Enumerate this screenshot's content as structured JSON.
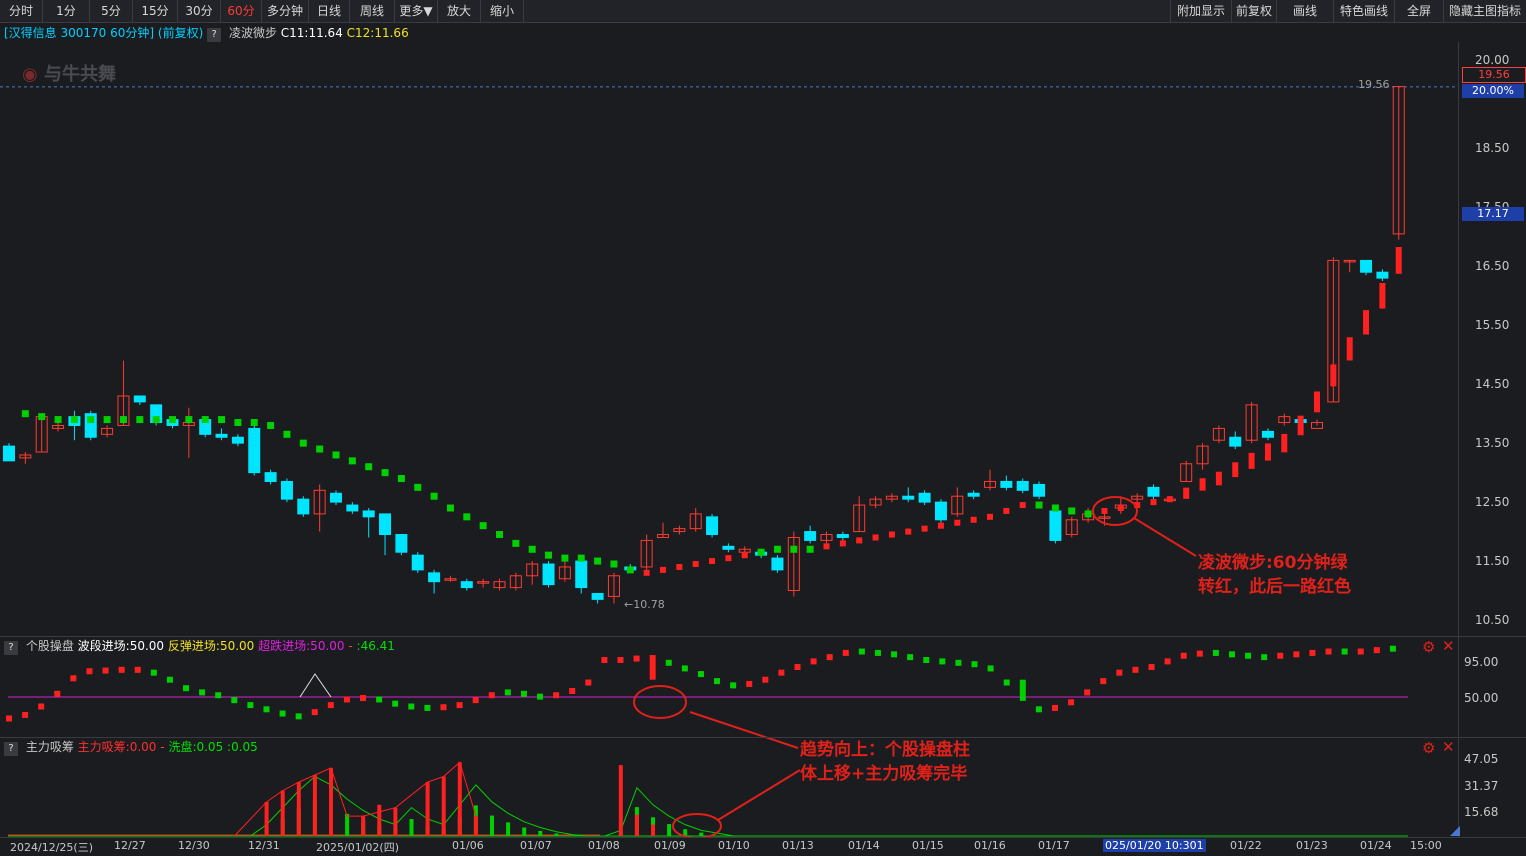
{
  "toolbar": {
    "left": [
      "分时",
      "1分",
      "5分",
      "15分",
      "30分",
      "60分",
      "多分钟",
      "日线",
      "周线",
      "更多▼",
      "放大",
      "缩小"
    ],
    "active_index": 5,
    "right": [
      "附加显示",
      "前复权",
      "画线",
      "特色画线",
      "全屏",
      "隐藏主图指标"
    ]
  },
  "header": {
    "stock": "[汉得信息 300170 60分钟]",
    "adjust": "(前复权)",
    "indicator_name": "凌波微步",
    "c1": "C11:11.64",
    "c2": "C12:11.66",
    "watermark": "与牛共舞"
  },
  "price_axis": {
    "labels": [
      "20.00",
      "18.50",
      "17.50",
      "16.50",
      "15.50",
      "14.50",
      "13.50",
      "12.50",
      "11.50",
      "10.50"
    ],
    "tag_high_price": "19.56",
    "tag_high_pct": "20.00%",
    "tag_last": "17.17",
    "peak_label": "19.56",
    "low_label": "10.78"
  },
  "panel2": {
    "name": "个股操盘",
    "s1": "波段进场:50.00",
    "s2": "反弹进场:50.00",
    "s3": "超跌进场:50.00",
    "s4": ":46.41",
    "labels": [
      "95.00",
      "50.00"
    ]
  },
  "panel3": {
    "name": "主力吸筹",
    "s1": "主力吸筹:0.00",
    "s2": "洗盘:0.05",
    "s3": ":0.05",
    "labels": [
      "47.05",
      "31.37",
      "15.68"
    ]
  },
  "dates": [
    "2024/12/25(三)",
    "12/27",
    "12/30",
    "12/31",
    "2025/01/02(四)",
    "01/06",
    "01/07",
    "01/08",
    "01/09",
    "01/10",
    "01/13",
    "01/14",
    "01/15",
    "01/16",
    "01/17",
    "025/01/20 10:301",
    "01/22",
    "01/23",
    "01/24",
    "15:00"
  ],
  "annotations": {
    "a1_line1": "凌波微步:60分钟绿",
    "a1_line2": "转红，此后一路红色",
    "a2_line1": "趋势向上：个股操盘柱",
    "a2_line2": "体上移+主力吸筹完毕"
  },
  "colors": {
    "up": "#ff3b30",
    "down": "#00e5ff",
    "green": "#00d000",
    "red": "#ff2020",
    "magenta": "#d020d0",
    "yellow": "#f0e020"
  },
  "chart_data": {
    "type": "candlestick",
    "ylim": [
      10.2,
      20.5
    ],
    "candles": [
      [
        13.45,
        13.2,
        13.5,
        13.2
      ],
      [
        13.25,
        13.3,
        13.35,
        13.15
      ],
      [
        13.35,
        13.95,
        14.0,
        13.35
      ],
      [
        13.75,
        13.8,
        13.95,
        13.7
      ],
      [
        13.95,
        13.8,
        14.05,
        13.55
      ],
      [
        14.0,
        13.6,
        14.05,
        13.55
      ],
      [
        13.65,
        13.75,
        13.8,
        13.6
      ],
      [
        13.8,
        14.3,
        14.9,
        13.8
      ],
      [
        14.3,
        14.2,
        14.3,
        14.15
      ],
      [
        14.15,
        13.85,
        14.15,
        13.8
      ],
      [
        13.9,
        13.8,
        13.95,
        13.75
      ],
      [
        13.8,
        13.85,
        14.1,
        13.25
      ],
      [
        13.9,
        13.65,
        13.9,
        13.6
      ],
      [
        13.65,
        13.6,
        13.75,
        13.55
      ],
      [
        13.6,
        13.5,
        13.65,
        13.45
      ],
      [
        13.75,
        13.0,
        13.8,
        12.95
      ],
      [
        13.0,
        12.85,
        13.05,
        12.8
      ],
      [
        12.85,
        12.55,
        12.9,
        12.5
      ],
      [
        12.55,
        12.3,
        12.6,
        12.25
      ],
      [
        12.3,
        12.7,
        12.8,
        12.0
      ],
      [
        12.65,
        12.5,
        12.7,
        12.45
      ],
      [
        12.45,
        12.35,
        12.5,
        12.3
      ],
      [
        12.35,
        12.25,
        12.4,
        11.9
      ],
      [
        12.3,
        11.95,
        12.3,
        11.6
      ],
      [
        11.95,
        11.65,
        11.95,
        11.6
      ],
      [
        11.6,
        11.35,
        11.65,
        11.3
      ],
      [
        11.3,
        11.15,
        11.35,
        10.95
      ],
      [
        11.2,
        11.2,
        11.25,
        11.15
      ],
      [
        11.15,
        11.05,
        11.2,
        11.0
      ],
      [
        11.15,
        11.15,
        11.2,
        11.05
      ],
      [
        11.05,
        11.15,
        11.2,
        11.0
      ],
      [
        11.05,
        11.25,
        11.3,
        11.0
      ],
      [
        11.25,
        11.45,
        11.5,
        11.1
      ],
      [
        11.45,
        11.1,
        11.5,
        11.05
      ],
      [
        11.2,
        11.4,
        11.5,
        11.15
      ],
      [
        11.5,
        11.05,
        11.6,
        10.95
      ],
      [
        10.95,
        10.85,
        10.95,
        10.78
      ],
      [
        10.9,
        11.25,
        11.3,
        10.78
      ],
      [
        11.4,
        11.35,
        11.45,
        11.3
      ],
      [
        11.4,
        11.85,
        11.95,
        11.35
      ],
      [
        11.9,
        11.95,
        12.15,
        11.9
      ],
      [
        12.0,
        12.05,
        12.1,
        11.95
      ],
      [
        12.05,
        12.3,
        12.4,
        12.0
      ],
      [
        12.25,
        11.95,
        12.3,
        11.9
      ],
      [
        11.75,
        11.7,
        11.8,
        11.65
      ],
      [
        11.65,
        11.7,
        11.75,
        11.6
      ],
      [
        11.65,
        11.6,
        11.7,
        11.55
      ],
      [
        11.55,
        11.35,
        11.6,
        11.3
      ],
      [
        11.0,
        11.9,
        12.0,
        10.9
      ],
      [
        12.0,
        11.85,
        12.1,
        11.8
      ],
      [
        11.85,
        11.95,
        12.0,
        11.8
      ],
      [
        11.95,
        11.9,
        12.0,
        11.85
      ],
      [
        12.0,
        12.45,
        12.6,
        12.0
      ],
      [
        12.45,
        12.55,
        12.6,
        12.4
      ],
      [
        12.55,
        12.6,
        12.65,
        12.5
      ],
      [
        12.6,
        12.55,
        12.75,
        12.5
      ],
      [
        12.65,
        12.5,
        12.7,
        12.45
      ],
      [
        12.5,
        12.2,
        12.55,
        12.15
      ],
      [
        12.3,
        12.6,
        12.75,
        12.25
      ],
      [
        12.65,
        12.6,
        12.7,
        12.55
      ],
      [
        12.75,
        12.85,
        13.05,
        12.7
      ],
      [
        12.85,
        12.75,
        12.95,
        12.7
      ],
      [
        12.85,
        12.7,
        12.9,
        12.65
      ],
      [
        12.8,
        12.6,
        12.85,
        12.55
      ],
      [
        12.35,
        11.85,
        12.4,
        11.8
      ],
      [
        11.95,
        12.2,
        12.25,
        11.9
      ],
      [
        12.2,
        12.3,
        12.4,
        12.15
      ],
      [
        12.25,
        12.25,
        12.3,
        12.1
      ],
      [
        12.4,
        12.45,
        12.6,
        12.3
      ],
      [
        12.55,
        12.6,
        12.65,
        12.5
      ],
      [
        12.75,
        12.6,
        12.8,
        12.55
      ],
      [
        12.55,
        12.55,
        12.6,
        12.5
      ],
      [
        12.85,
        13.15,
        13.2,
        12.85
      ],
      [
        13.15,
        13.45,
        13.5,
        13.05
      ],
      [
        13.55,
        13.75,
        13.8,
        13.5
      ],
      [
        13.6,
        13.45,
        13.7,
        13.4
      ],
      [
        13.55,
        14.15,
        14.2,
        13.5
      ],
      [
        13.7,
        13.6,
        13.75,
        13.55
      ],
      [
        13.85,
        13.95,
        14.0,
        13.8
      ],
      [
        13.9,
        13.85,
        13.95,
        13.8
      ],
      [
        13.75,
        13.85,
        13.9,
        13.8
      ],
      [
        14.2,
        16.6,
        16.65,
        14.2
      ],
      [
        16.6,
        16.6,
        16.6,
        16.4
      ],
      [
        16.6,
        16.4,
        16.6,
        16.35
      ],
      [
        16.4,
        16.3,
        16.45,
        16.25
      ],
      [
        17.05,
        19.55,
        19.56,
        16.95
      ]
    ],
    "lingbo": [
      [
        14.0,
        "g"
      ],
      [
        13.95,
        "g"
      ],
      [
        13.9,
        "g"
      ],
      [
        13.9,
        "g"
      ],
      [
        13.9,
        "g"
      ],
      [
        13.9,
        "g"
      ],
      [
        13.9,
        "g"
      ],
      [
        13.9,
        "g"
      ],
      [
        13.9,
        "g"
      ],
      [
        13.9,
        "g"
      ],
      [
        13.9,
        "g"
      ],
      [
        13.9,
        "g"
      ],
      [
        13.9,
        "g"
      ],
      [
        13.85,
        "g"
      ],
      [
        13.85,
        "g"
      ],
      [
        13.8,
        "g"
      ],
      [
        13.65,
        "g"
      ],
      [
        13.5,
        "g"
      ],
      [
        13.4,
        "g"
      ],
      [
        13.3,
        "g"
      ],
      [
        13.2,
        "g"
      ],
      [
        13.1,
        "g"
      ],
      [
        13.0,
        "g"
      ],
      [
        12.9,
        "g"
      ],
      [
        12.75,
        "g"
      ],
      [
        12.6,
        "g"
      ],
      [
        12.4,
        "g"
      ],
      [
        12.25,
        "g"
      ],
      [
        12.1,
        "g"
      ],
      [
        11.95,
        "g"
      ],
      [
        11.8,
        "g"
      ],
      [
        11.7,
        "g"
      ],
      [
        11.6,
        "g"
      ],
      [
        11.55,
        "g"
      ],
      [
        11.55,
        "g"
      ],
      [
        11.5,
        "g"
      ],
      [
        11.45,
        "g"
      ],
      [
        11.35,
        "g"
      ],
      [
        11.3,
        "r"
      ],
      [
        11.35,
        "r"
      ],
      [
        11.4,
        "r"
      ],
      [
        11.45,
        "r"
      ],
      [
        11.5,
        "r"
      ],
      [
        11.55,
        "r"
      ],
      [
        11.6,
        "r"
      ],
      [
        11.65,
        "g"
      ],
      [
        11.7,
        "g"
      ],
      [
        11.7,
        "g"
      ],
      [
        11.7,
        "g"
      ],
      [
        11.75,
        "r"
      ],
      [
        11.8,
        "r"
      ],
      [
        11.85,
        "r"
      ],
      [
        11.9,
        "r"
      ],
      [
        11.95,
        "r"
      ],
      [
        12.0,
        "r"
      ],
      [
        12.05,
        "r"
      ],
      [
        12.1,
        "r"
      ],
      [
        12.15,
        "r"
      ],
      [
        12.2,
        "r"
      ],
      [
        12.25,
        "r"
      ],
      [
        12.35,
        "r"
      ],
      [
        12.45,
        "r"
      ],
      [
        12.45,
        "g"
      ],
      [
        12.4,
        "g"
      ],
      [
        12.35,
        "g"
      ],
      [
        12.3,
        "g"
      ],
      [
        12.35,
        "r"
      ],
      [
        12.4,
        "r"
      ],
      [
        12.45,
        "r"
      ],
      [
        12.5,
        "r"
      ],
      [
        12.55,
        "r"
      ],
      [
        12.65,
        "r"
      ],
      [
        12.8,
        "r"
      ],
      [
        12.9,
        "r"
      ],
      [
        13.05,
        "r"
      ],
      [
        13.2,
        "r"
      ],
      [
        13.35,
        "r"
      ],
      [
        13.5,
        "r"
      ],
      [
        13.8,
        "r"
      ],
      [
        14.2,
        "r"
      ],
      [
        14.65,
        "r"
      ],
      [
        15.1,
        "r"
      ],
      [
        15.55,
        "r"
      ],
      [
        16.0,
        "r"
      ],
      [
        16.6,
        "r"
      ]
    ],
    "panel2_values": [
      [
        5,
        "r"
      ],
      [
        10,
        "r"
      ],
      [
        22,
        "r"
      ],
      [
        40,
        "r"
      ],
      [
        62,
        "r"
      ],
      [
        72,
        "r"
      ],
      [
        73,
        "r"
      ],
      [
        74,
        "r"
      ],
      [
        74,
        "r"
      ],
      [
        70,
        "g"
      ],
      [
        60,
        "g"
      ],
      [
        48,
        "g"
      ],
      [
        42,
        "g"
      ],
      [
        38,
        "g"
      ],
      [
        31,
        "g"
      ],
      [
        24,
        "g"
      ],
      [
        18,
        "g"
      ],
      [
        12,
        "g"
      ],
      [
        8,
        "g"
      ],
      [
        14,
        "r"
      ],
      [
        24,
        "r"
      ],
      [
        32,
        "r"
      ],
      [
        34,
        "r"
      ],
      [
        32,
        "g"
      ],
      [
        26,
        "g"
      ],
      [
        22,
        "g"
      ],
      [
        20,
        "g"
      ],
      [
        21,
        "r"
      ],
      [
        24,
        "r"
      ],
      [
        31,
        "r"
      ],
      [
        38,
        "r"
      ],
      [
        42,
        "g"
      ],
      [
        40,
        "g"
      ],
      [
        36,
        "g"
      ],
      [
        38,
        "r"
      ],
      [
        44,
        "r"
      ],
      [
        56,
        "r"
      ],
      [
        88,
        "r"
      ],
      [
        88,
        "r"
      ],
      [
        90,
        "r"
      ],
      [
        88,
        "g"
      ],
      [
        84,
        "g"
      ],
      [
        76,
        "g"
      ],
      [
        68,
        "g"
      ],
      [
        58,
        "g"
      ],
      [
        52,
        "g"
      ],
      [
        54,
        "r"
      ],
      [
        60,
        "r"
      ],
      [
        70,
        "r"
      ],
      [
        78,
        "r"
      ],
      [
        86,
        "r"
      ],
      [
        92,
        "r"
      ],
      [
        98,
        "r"
      ],
      [
        100,
        "g"
      ],
      [
        98,
        "g"
      ],
      [
        96,
        "g"
      ],
      [
        92,
        "g"
      ],
      [
        88,
        "g"
      ],
      [
        86,
        "g"
      ],
      [
        84,
        "g"
      ],
      [
        82,
        "g"
      ],
      [
        76,
        "g"
      ],
      [
        56,
        "g"
      ],
      [
        30,
        "g"
      ],
      [
        18,
        "g"
      ],
      [
        20,
        "r"
      ],
      [
        28,
        "r"
      ],
      [
        42,
        "r"
      ],
      [
        58,
        "r"
      ],
      [
        70,
        "r"
      ],
      [
        74,
        "r"
      ],
      [
        78,
        "r"
      ],
      [
        86,
        "r"
      ],
      [
        94,
        "r"
      ],
      [
        97,
        "r"
      ],
      [
        98,
        "g"
      ],
      [
        96,
        "g"
      ],
      [
        94,
        "g"
      ],
      [
        92,
        "g"
      ],
      [
        94,
        "r"
      ],
      [
        96,
        "r"
      ],
      [
        98,
        "r"
      ],
      [
        100,
        "r"
      ],
      [
        100,
        "g"
      ],
      [
        100,
        "r"
      ],
      [
        102,
        "r"
      ],
      [
        104,
        "g"
      ]
    ],
    "panel3_red": [
      [
        0,
        0
      ],
      [
        14,
        0
      ],
      [
        16,
        24
      ],
      [
        17,
        32
      ],
      [
        18,
        38
      ],
      [
        19,
        43
      ],
      [
        20,
        48
      ],
      [
        22,
        14
      ],
      [
        23,
        22
      ],
      [
        24,
        20
      ],
      [
        26,
        38
      ],
      [
        27,
        42
      ],
      [
        28,
        52
      ],
      [
        29,
        14
      ],
      [
        38,
        50
      ],
      [
        39,
        15
      ],
      [
        40,
        8
      ]
    ],
    "panel3_green_line": [
      0,
      0,
      0,
      0,
      0,
      0,
      0,
      0,
      0,
      0,
      0,
      0,
      0,
      0,
      0,
      0,
      8,
      20,
      32,
      42,
      36,
      26,
      18,
      12,
      8,
      20,
      12,
      8,
      22,
      36,
      24,
      16,
      10,
      6,
      3,
      1,
      0,
      0,
      4,
      34,
      22,
      14,
      8,
      4,
      2,
      0,
      0,
      0,
      0,
      0,
      0,
      0,
      0,
      0,
      0,
      0,
      0,
      0,
      0,
      0,
      0,
      0,
      0,
      0,
      0,
      0,
      0,
      0,
      0,
      0,
      0,
      0,
      0,
      0,
      0,
      0,
      0,
      0,
      0,
      0,
      0,
      0,
      0,
      0,
      0,
      0,
      0
    ]
  }
}
